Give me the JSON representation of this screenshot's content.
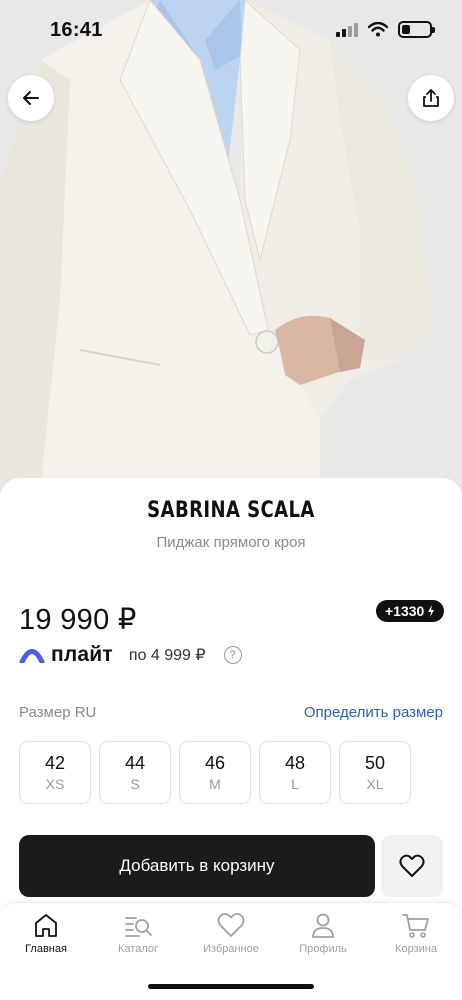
{
  "status_bar": {
    "time": "16:41",
    "battery_level": 0.3
  },
  "nav": {
    "back_icon": "arrow-left-icon",
    "share_icon": "share-icon"
  },
  "product": {
    "brand": "SABRINA SCALA",
    "name": "Пиджак прямого кроя",
    "price": "19 990 ₽",
    "bonus": "+1330",
    "split": {
      "logo": "плайт",
      "installment": "по 4 999 ₽",
      "help": "?"
    }
  },
  "sizes": {
    "label": "Размер RU",
    "detect_link": "Определить размер",
    "options": [
      {
        "ru": "42",
        "intl": "XS"
      },
      {
        "ru": "44",
        "intl": "S"
      },
      {
        "ru": "46",
        "intl": "M"
      },
      {
        "ru": "48",
        "intl": "L"
      },
      {
        "ru": "50",
        "intl": "XL"
      }
    ]
  },
  "actions": {
    "add_to_cart": "Добавить в корзину",
    "favorite_icon": "heart-icon"
  },
  "tabbar": {
    "items": [
      {
        "label": "Главная",
        "icon": "home-icon",
        "active": true
      },
      {
        "label": "Каталог",
        "icon": "catalog-icon",
        "active": false
      },
      {
        "label": "Избранное",
        "icon": "heart-icon",
        "active": false
      },
      {
        "label": "Профиль",
        "icon": "profile-icon",
        "active": false
      },
      {
        "label": "Корзина",
        "icon": "cart-icon",
        "active": false
      }
    ]
  },
  "colors": {
    "accent_link": "#2f5fb3",
    "split_logo": "#4a5cf0",
    "button_dark": "#1b1b1b"
  }
}
